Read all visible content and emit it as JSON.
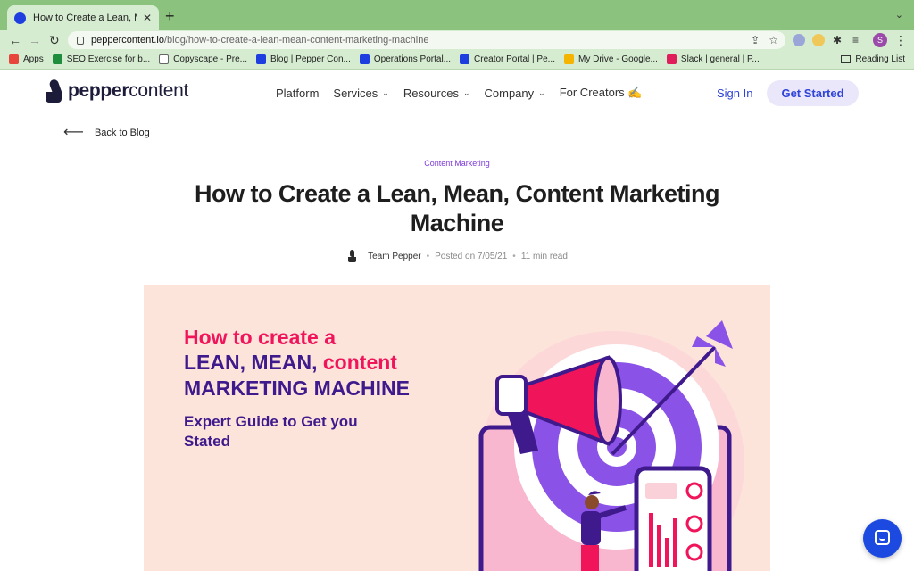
{
  "browser": {
    "tab_title": "How to Create a Lean, Mean, C",
    "tab_close": "✕",
    "new_tab": "+",
    "url_host": "peppercontent.io",
    "url_path": "/blog/how-to-create-a-lean-mean-content-marketing-machine",
    "profile_initial": "S",
    "bookmarks": [
      {
        "label": "Apps",
        "icon": "apps-grid-icon",
        "color": "#e8453c"
      },
      {
        "label": "SEO Exercise for b...",
        "icon": "sheets-icon",
        "color": "#1e8e3e"
      },
      {
        "label": "Copyscape - Pre...",
        "icon": "copyscape-icon",
        "color": "#ffffff"
      },
      {
        "label": "Blog | Pepper Con...",
        "icon": "pepper-icon",
        "color": "#1f3ee0"
      },
      {
        "label": "Operations Portal...",
        "icon": "pepper-icon",
        "color": "#1f3ee0"
      },
      {
        "label": "Creator Portal | Pe...",
        "icon": "pepper-icon",
        "color": "#1f3ee0"
      },
      {
        "label": "My Drive - Google...",
        "icon": "drive-icon",
        "color": "#f4b400"
      },
      {
        "label": "Slack | general | P...",
        "icon": "slack-icon",
        "color": "#e01e5a"
      }
    ],
    "reading_list": "Reading List"
  },
  "header": {
    "logo_bold": "pepper",
    "logo_light": "content",
    "nav": [
      {
        "label": "Platform",
        "caret": false
      },
      {
        "label": "Services",
        "caret": true
      },
      {
        "label": "Resources",
        "caret": true
      },
      {
        "label": "Company",
        "caret": true
      },
      {
        "label": "For Creators ✍️",
        "caret": false
      }
    ],
    "sign_in": "Sign In",
    "get_started": "Get Started"
  },
  "article": {
    "back_label": "Back to Blog",
    "category": "Content Marketing",
    "title": "How to Create a Lean, Mean, Content Marketing Machine",
    "author": "Team Pepper",
    "posted": "Posted on 7/05/21",
    "read_time": "11 min read",
    "dot": "•"
  },
  "hero": {
    "line1": "How to create a",
    "line2_a": "LEAN, MEAN,",
    "line2_b": "content",
    "line3": "MARKETING MACHINE",
    "subtitle": "Expert Guide to Get you Stated",
    "colors": {
      "background": "#fde4da",
      "pink": "#f0145b",
      "purple": "#3f1a8c",
      "violet": "#8a52e6"
    }
  }
}
